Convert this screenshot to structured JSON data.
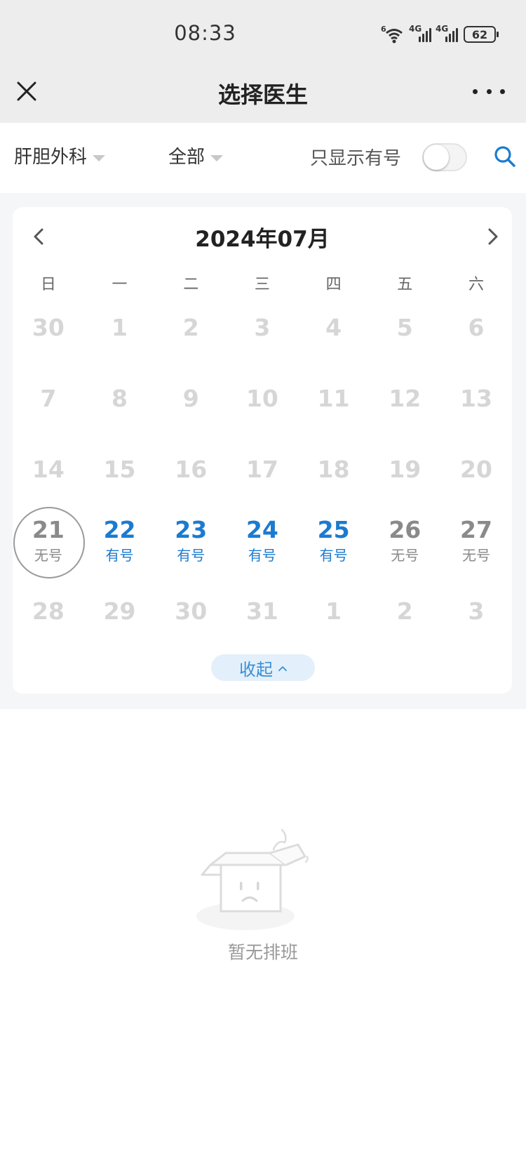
{
  "status_bar": {
    "time": "08:33",
    "wifi_badge": "6",
    "signal_1_label": "4G",
    "signal_2_label": "4G",
    "battery": "62"
  },
  "nav": {
    "title": "选择医生",
    "close_icon": "close-icon",
    "more_icon": "more-icon"
  },
  "filters": {
    "department": "肝胆外科",
    "type": "全部",
    "only_available_label": "只显示有号",
    "only_available_on": false
  },
  "calendar": {
    "month_title": "2024年07月",
    "weekdays": [
      "日",
      "一",
      "二",
      "三",
      "四",
      "五",
      "六"
    ],
    "days": [
      {
        "num": "30",
        "status": ""
      },
      {
        "num": "1",
        "status": ""
      },
      {
        "num": "2",
        "status": ""
      },
      {
        "num": "3",
        "status": ""
      },
      {
        "num": "4",
        "status": ""
      },
      {
        "num": "5",
        "status": ""
      },
      {
        "num": "6",
        "status": ""
      },
      {
        "num": "7",
        "status": ""
      },
      {
        "num": "8",
        "status": ""
      },
      {
        "num": "9",
        "status": ""
      },
      {
        "num": "10",
        "status": ""
      },
      {
        "num": "11",
        "status": ""
      },
      {
        "num": "12",
        "status": ""
      },
      {
        "num": "13",
        "status": ""
      },
      {
        "num": "14",
        "status": ""
      },
      {
        "num": "15",
        "status": ""
      },
      {
        "num": "16",
        "status": ""
      },
      {
        "num": "17",
        "status": ""
      },
      {
        "num": "18",
        "status": ""
      },
      {
        "num": "19",
        "status": ""
      },
      {
        "num": "20",
        "status": ""
      },
      {
        "num": "21",
        "status": "无号"
      },
      {
        "num": "22",
        "status": "有号"
      },
      {
        "num": "23",
        "status": "有号"
      },
      {
        "num": "24",
        "status": "有号"
      },
      {
        "num": "25",
        "status": "有号"
      },
      {
        "num": "26",
        "status": "无号"
      },
      {
        "num": "27",
        "status": "无号"
      },
      {
        "num": "28",
        "status": ""
      },
      {
        "num": "29",
        "status": ""
      },
      {
        "num": "30",
        "status": ""
      },
      {
        "num": "31",
        "status": ""
      },
      {
        "num": "1",
        "status": ""
      },
      {
        "num": "2",
        "status": ""
      },
      {
        "num": "3",
        "status": ""
      }
    ],
    "collapse_label": "收起",
    "colors": {
      "available": "#1a7bd0",
      "full": "#8a8a8a",
      "disabled": "#d6d6d6"
    }
  },
  "empty_state": {
    "text": "暂无排班",
    "icon": "empty-box-icon"
  }
}
